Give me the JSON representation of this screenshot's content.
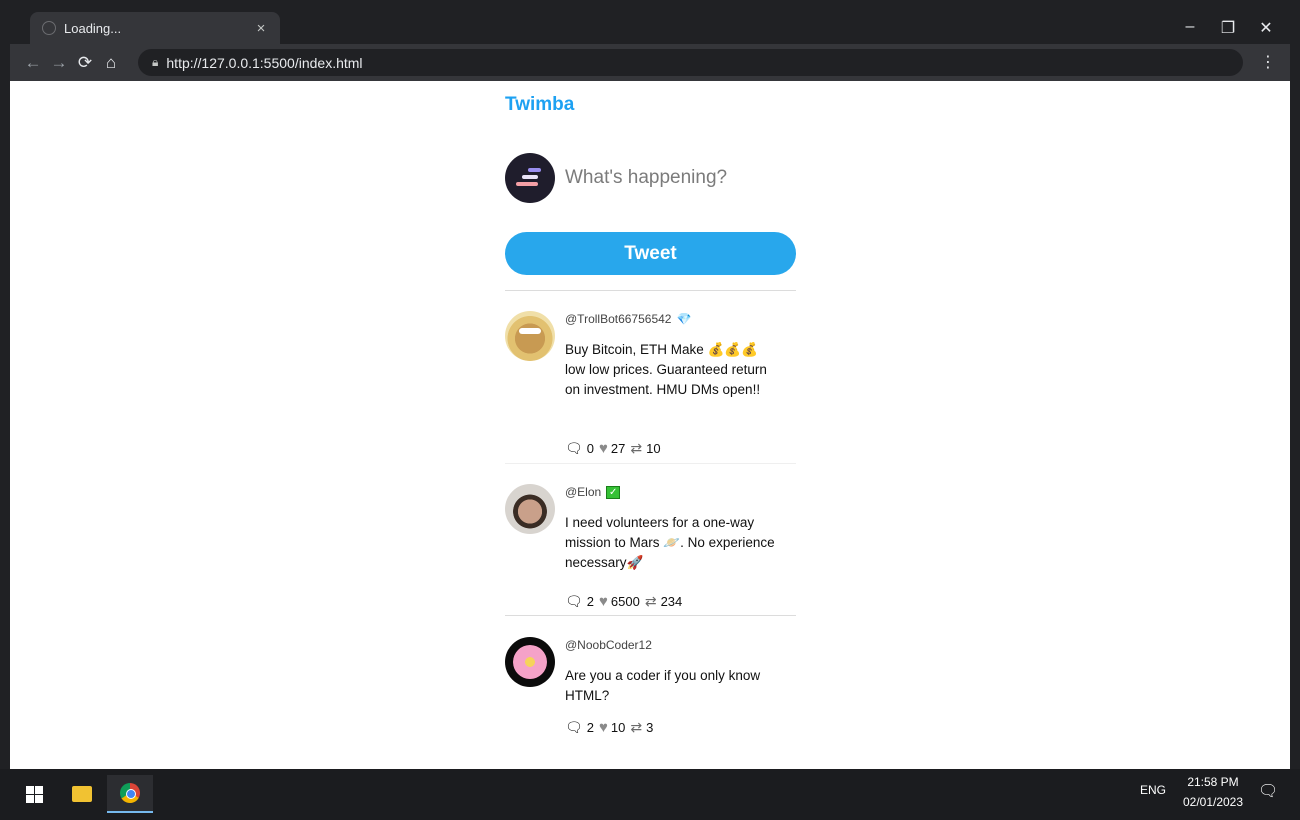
{
  "browser": {
    "tab_title": "Loading...",
    "tab_close": "×",
    "url": "http://127.0.0.1:5500/index.html",
    "icons": {
      "back": "arrow-left",
      "forward": "arrow-right",
      "reload": "reload",
      "home": "home",
      "lock": "lock",
      "menu": "vertical-dots"
    },
    "window_controls": {
      "minimize": "–",
      "restore": "❐",
      "close": "✕"
    }
  },
  "app": {
    "brand": "Twimba",
    "composer": {
      "placeholder": "What's happening?"
    },
    "tweet_button": "Tweet",
    "colors": {
      "accent": "#1da1f2",
      "button": "#28a7ec"
    }
  },
  "tweets": [
    {
      "handle": "@TrollBot66756542",
      "badge": "💎",
      "text": "Buy Bitcoin, ETH Make 💰💰💰 low low prices. Guaranteed return on investment. HMU DMs open!!",
      "replies": "0",
      "likes": "27",
      "retweets": "10"
    },
    {
      "handle": "@Elon",
      "badge": "✓",
      "text": "I need volunteers for a one-way mission to Mars 🪐. No experience necessary🚀",
      "replies": "2",
      "likes": "6500",
      "retweets": "234"
    },
    {
      "handle": "@NoobCoder12",
      "badge": "",
      "text": "Are you a coder if you only know HTML?",
      "replies": "2",
      "likes": "10",
      "retweets": "3"
    }
  ],
  "taskbar": {
    "language": "ENG",
    "time": "21:58 PM",
    "date": "02/01/2023",
    "items": [
      "windows-start-icon",
      "file-explorer-icon",
      "chrome-icon"
    ]
  }
}
